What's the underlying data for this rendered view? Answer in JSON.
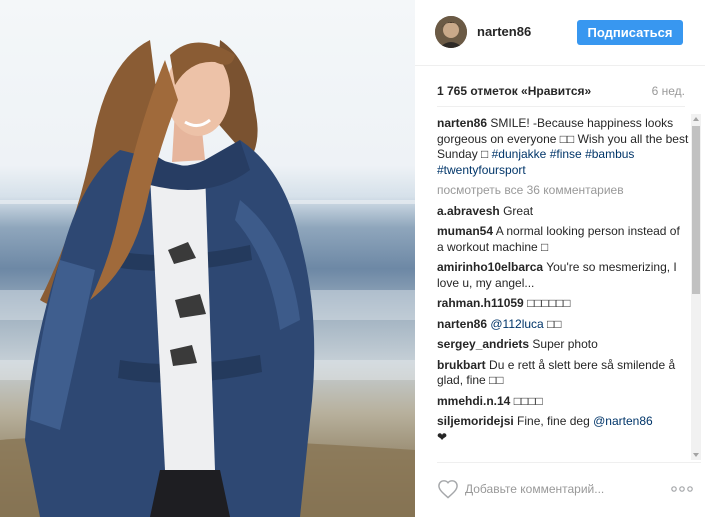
{
  "header": {
    "username": "narten86",
    "follow_label": "Подписаться"
  },
  "stats": {
    "likes": "1 765 отметок «Нравится»",
    "age": "6 нед."
  },
  "caption": {
    "user": "narten86",
    "text": "SMILE! -Because happiness looks gorgeous on everyone □□ Wish you all the best Sunday □ ",
    "tags": [
      "#dunjakke",
      "#finse",
      "#bambus",
      "#twentyfoursport"
    ]
  },
  "load_more": "посмотреть все 36 комментариев",
  "comments": [
    {
      "user": "a.abravesh",
      "text": "Great"
    },
    {
      "user": "muman54",
      "text": "A normal looking person instead of a workout machine □"
    },
    {
      "user": "amirinho10elbarca",
      "text": "You're so mesmerizing, I love u, my angel..."
    },
    {
      "user": "rahman.h11059",
      "text": "□□□□□□"
    },
    {
      "user": "narten86",
      "mention": "@112luca",
      "text": " □□"
    },
    {
      "user": "sergey_andriets",
      "text": "Super photo"
    },
    {
      "user": "brukbart",
      "text": "Du e rett å slett bere så smilende å glad, fine □□"
    },
    {
      "user": "mmehdi.n.14",
      "text": "□□□□"
    },
    {
      "user": "siljemoridejsi",
      "text": "Fine, fine deg ",
      "mention": "@narten86",
      "after": "❤"
    }
  ],
  "footer": {
    "comment_placeholder": "Добавьте комментарий...",
    "like_icon": "heart-outline-icon",
    "more_icon": "ellipsis-icon"
  },
  "colors": {
    "accent": "#3897f0",
    "link": "#003569",
    "muted": "#999999"
  }
}
